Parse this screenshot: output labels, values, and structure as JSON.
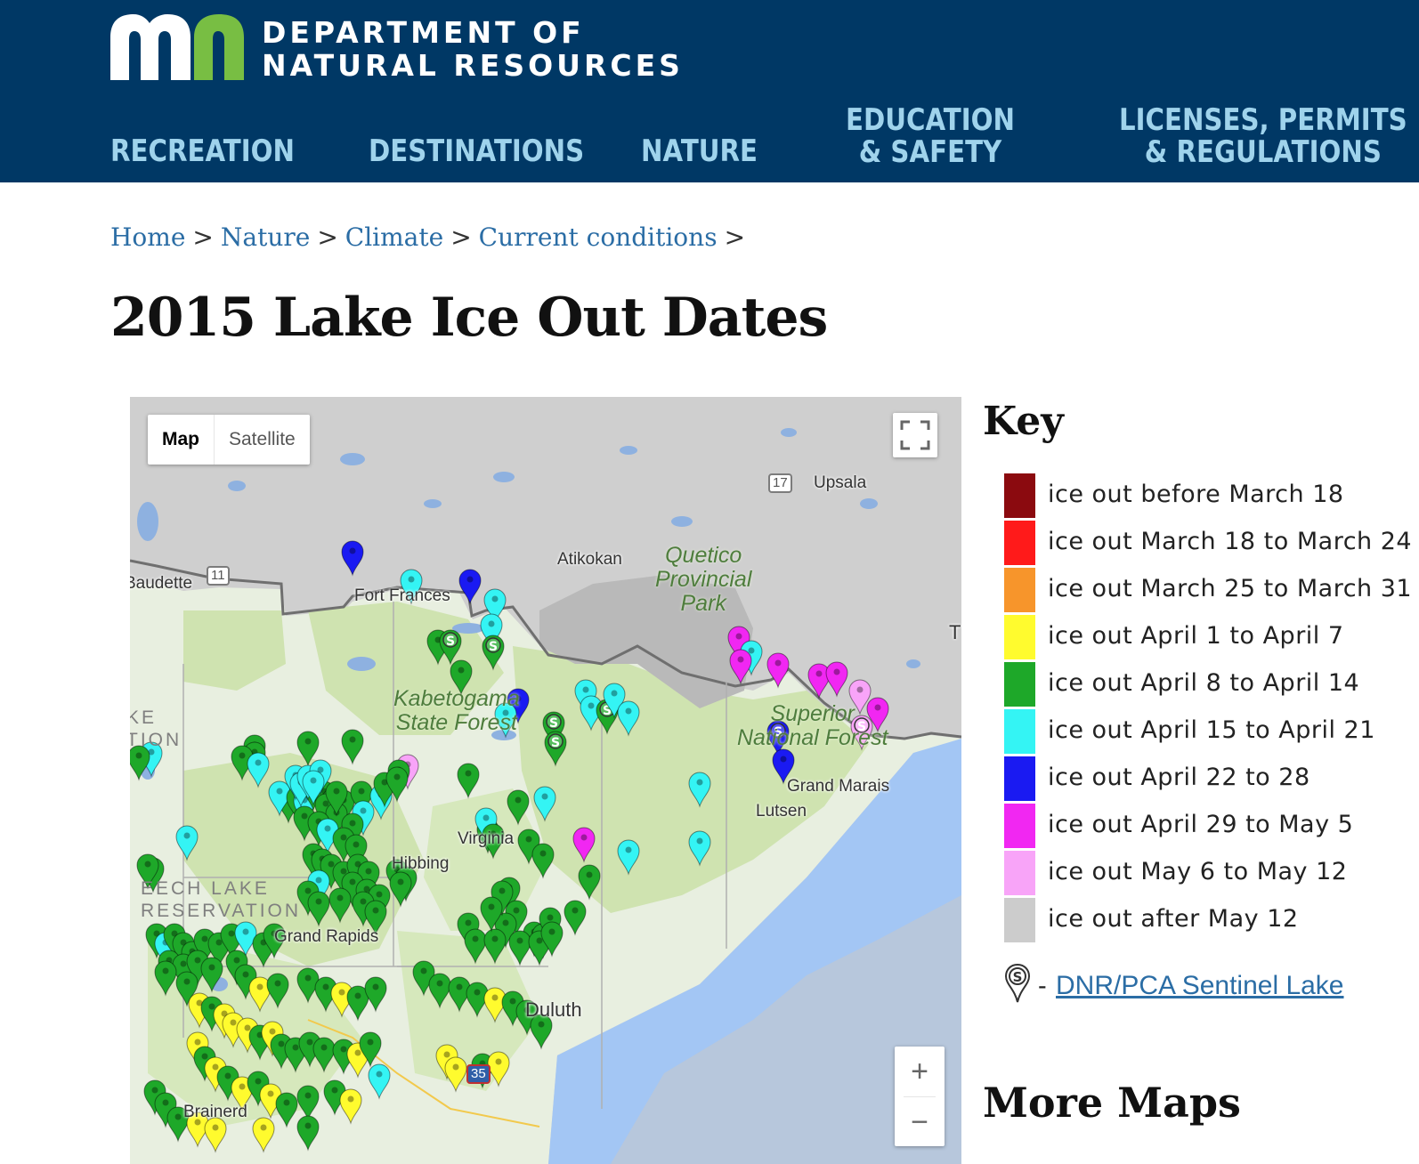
{
  "header": {
    "logo_line1": "DEPARTMENT OF",
    "logo_line2": "NATURAL RESOURCES",
    "logo_colors": {
      "m": "#ffffff",
      "n": "#78be43"
    },
    "background": "#003865",
    "nav_color": "#9fd3ec"
  },
  "nav": {
    "recreation": "RECREATION",
    "destinations": "DESTINATIONS",
    "nature": "NATURE",
    "education_1": "EDUCATION",
    "education_2": "& SAFETY",
    "licenses_1": "LICENSES, PERMITS",
    "licenses_2": "& REGULATIONS"
  },
  "breadcrumb": {
    "home": "Home",
    "nature": "Nature",
    "climate": "Climate",
    "current": "Current conditions",
    "separator": ">"
  },
  "page_title": "2015 Lake Ice Out Dates",
  "map": {
    "type_buttons": {
      "map": "Map",
      "satellite": "Satellite"
    },
    "zoom_in": "+",
    "zoom_out": "−",
    "places": {
      "upsala": "Upsala",
      "atikokan": "Atikokan",
      "baudette": "Baudette",
      "fort_frances": "Fort Frances",
      "hibbing": "Hibbing",
      "grand_rapids": "Grand Rapids",
      "grand_marais": "Grand Marais",
      "lutsen": "Lutsen",
      "duluth": "Duluth",
      "brainerd": "Brainerd",
      "virginia": "Virginia",
      "edge_t": "T"
    },
    "parks": {
      "quetico_1": "Quetico",
      "quetico_2": "Provincial",
      "quetico_3": "Park",
      "kabetogama_1": "Kabetogama",
      "kabetogama_2": "State Forest",
      "superior_1": "Superior",
      "superior_2": "National Forest"
    },
    "reservations": {
      "leech_1": "EECH LAKE",
      "leech_2": "RESERVATION",
      "left_1": "KE",
      "left_2": "TION"
    },
    "roads": {
      "hwy11": "11",
      "hwy17": "17",
      "i35": "35"
    },
    "sentinel_marker_letter": "S"
  },
  "key": {
    "title": "Key",
    "items": [
      {
        "label": "ice out before March 18",
        "color": "#8b0a0f"
      },
      {
        "label": "ice out March 18 to March 24",
        "color": "#ff1a1a"
      },
      {
        "label": "ice out March 25 to March 31",
        "color": "#f7952b"
      },
      {
        "label": "ice out April 1 to April 7",
        "color": "#fffb2e"
      },
      {
        "label": "ice out April 8 to April 14",
        "color": "#1ea829"
      },
      {
        "label": "ice out April 15 to April 21",
        "color": "#34f4f4"
      },
      {
        "label": "ice out April 22 to 28",
        "color": "#1a1af2"
      },
      {
        "label": "ice out April 29 to May 5",
        "color": "#f127f2"
      },
      {
        "label": "ice out May 6 to May 12",
        "color": "#f8a4f8"
      },
      {
        "label": "ice out after May 12",
        "color": "#cccccc"
      }
    ],
    "sentinel_dash": "-",
    "sentinel_link": "DNR/PCA Sentinel Lake"
  },
  "more_maps": "More Maps"
}
